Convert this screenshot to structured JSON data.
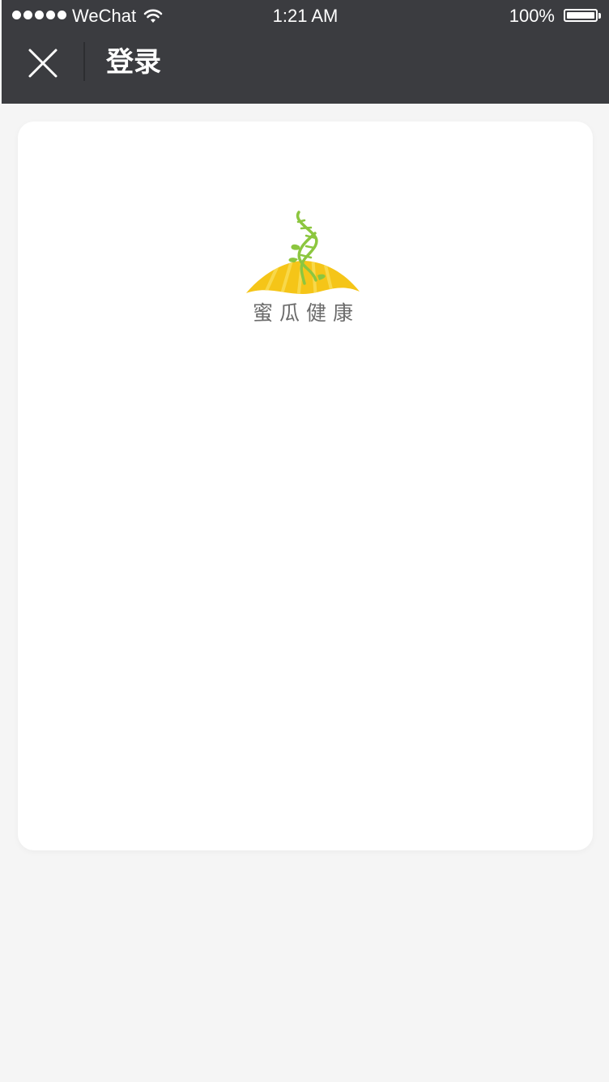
{
  "status_bar": {
    "carrier": "WeChat",
    "time": "1:21 AM",
    "battery_percent": "100%",
    "signal_bars": 5,
    "signal_icon": "signal-dots-icon",
    "wifi_icon": "wifi-icon",
    "battery_icon": "battery-icon"
  },
  "nav": {
    "title": "登录",
    "close_icon": "close-icon"
  },
  "card": {
    "logo_text": "蜜瓜健康",
    "logo_icon": "melon-dna-logo"
  },
  "colors": {
    "nav_background": "#3b3c40",
    "page_background": "#f5f5f5",
    "card_background": "#ffffff",
    "logo_green": "#8cc63f",
    "logo_yellow": "#f5c518",
    "logo_text": "#6b6b6b"
  }
}
